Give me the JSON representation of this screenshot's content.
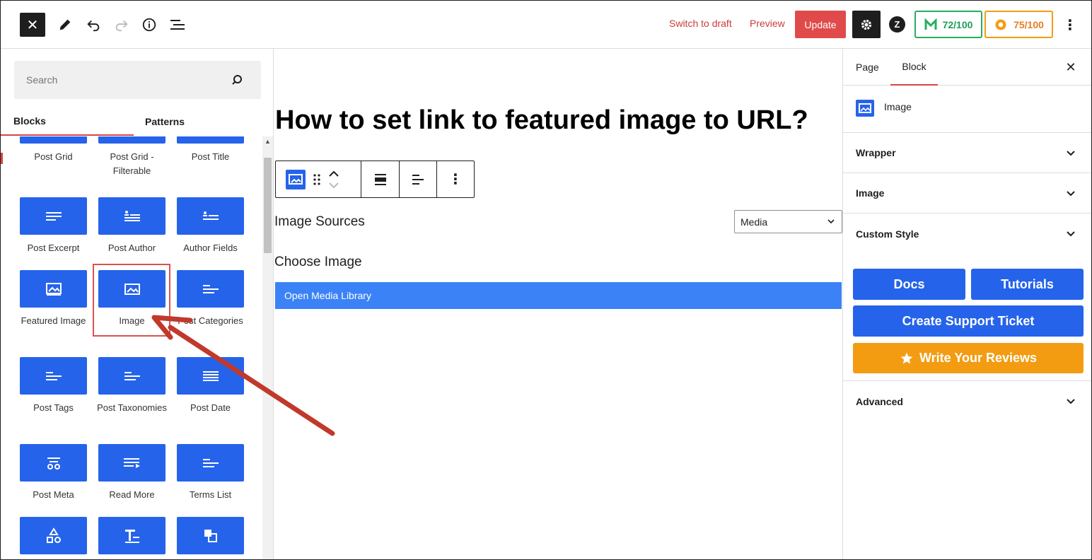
{
  "topbar": {
    "switch_to_draft": "Switch to draft",
    "preview": "Preview",
    "update": "Update",
    "score_seo": "72/100",
    "score_readability": "75/100"
  },
  "inserter": {
    "search_placeholder": "Search",
    "tabs": [
      "Blocks",
      "Patterns"
    ],
    "blocks": [
      {
        "label": "Post Grid",
        "icon": "grid-icon"
      },
      {
        "label": "Post Grid - Filterable",
        "icon": "grid-filter-icon"
      },
      {
        "label": "Post Title",
        "icon": "title-icon"
      },
      {
        "label": "Post Excerpt",
        "icon": "excerpt-icon"
      },
      {
        "label": "Post Author",
        "icon": "author-icon"
      },
      {
        "label": "Author Fields",
        "icon": "author-fields-icon"
      },
      {
        "label": "Featured Image",
        "icon": "featured-image-icon"
      },
      {
        "label": "Image",
        "icon": "image-icon"
      },
      {
        "label": "Post Categories",
        "icon": "categories-icon"
      },
      {
        "label": "Post Tags",
        "icon": "tags-icon"
      },
      {
        "label": "Post Taxonomies",
        "icon": "taxonomies-icon"
      },
      {
        "label": "Post Date",
        "icon": "date-icon"
      },
      {
        "label": "Post Meta",
        "icon": "meta-icon"
      },
      {
        "label": "Read More",
        "icon": "read-more-icon"
      },
      {
        "label": "Terms List",
        "icon": "terms-list-icon"
      },
      {
        "label": "",
        "icon": "shapes-icon"
      },
      {
        "label": "",
        "icon": "text-icon"
      },
      {
        "label": "",
        "icon": "copy-icon"
      }
    ]
  },
  "editor": {
    "title": "How to set link to featured image to URL?",
    "image_sources_label": "Image Sources",
    "image_source_selected": "Media",
    "choose_image_label": "Choose Image",
    "open_media_library": "Open Media Library"
  },
  "sidebar": {
    "tabs": [
      "Page",
      "Block"
    ],
    "block_name": "Image",
    "panels": [
      "Wrapper",
      "Image",
      "Custom Style"
    ],
    "docs": "Docs",
    "tutorials": "Tutorials",
    "create_support_ticket": "Create Support Ticket",
    "write_reviews": "Write Your Reviews",
    "advanced": "Advanced"
  },
  "colors": {
    "accent_blue": "#2563eb",
    "update_red": "#e04a4a",
    "review_orange": "#f39c12",
    "arrow": "#c0392b"
  }
}
